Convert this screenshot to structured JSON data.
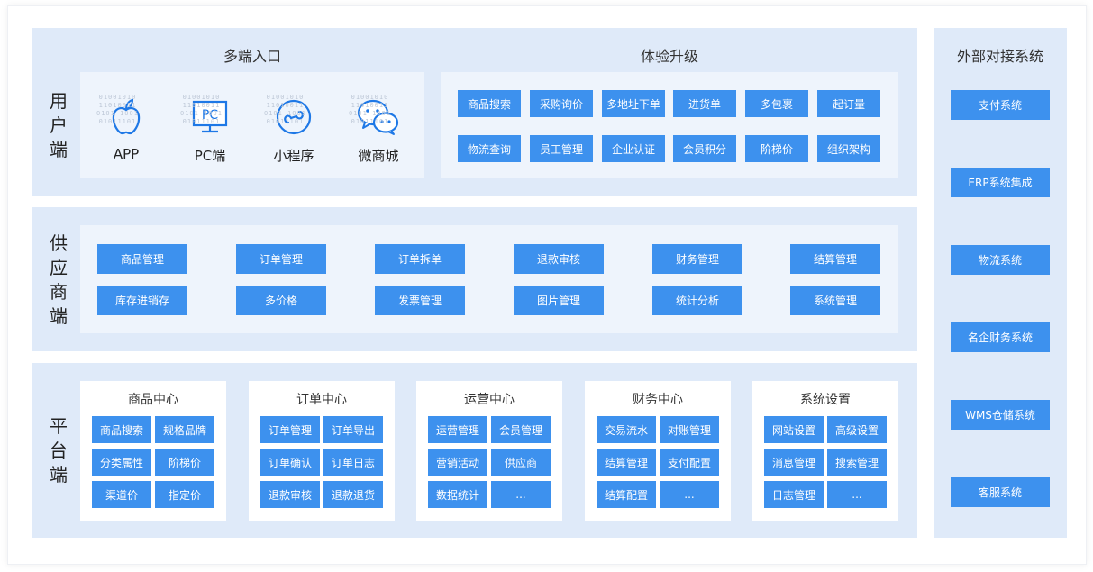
{
  "user_side": {
    "label": "用户端",
    "entries": {
      "title": "多端入口",
      "items": [
        {
          "label": "APP",
          "icon": "apple-icon"
        },
        {
          "label": "PC端",
          "icon": "pc-icon"
        },
        {
          "label": "小程序",
          "icon": "mini-program-icon"
        },
        {
          "label": "微商城",
          "icon": "wechat-icon"
        }
      ]
    },
    "experience": {
      "title": "体验升级",
      "row1": [
        "商品搜索",
        "采购询价",
        "多地址下单",
        "进货单",
        "多包裹",
        "起订量"
      ],
      "row2": [
        "物流查询",
        "员工管理",
        "企业认证",
        "会员积分",
        "阶梯价",
        "组织架构"
      ]
    }
  },
  "supplier_side": {
    "label": "供应商端",
    "row1": [
      "商品管理",
      "订单管理",
      "订单拆单",
      "退款审核",
      "财务管理",
      "结算管理"
    ],
    "row2": [
      "库存进销存",
      "多价格",
      "发票管理",
      "图片管理",
      "统计分析",
      "系统管理"
    ]
  },
  "platform_side": {
    "label": "平台端",
    "groups": [
      {
        "title": "商品中心",
        "items": [
          "商品搜索",
          "规格品牌",
          "分类属性",
          "阶梯价",
          "渠道价",
          "指定价"
        ]
      },
      {
        "title": "订单中心",
        "items": [
          "订单管理",
          "订单导出",
          "订单确认",
          "订单日志",
          "退款审核",
          "退款退货"
        ]
      },
      {
        "title": "运营中心",
        "items": [
          "运营管理",
          "会员管理",
          "营销活动",
          "供应商",
          "数据统计",
          "..."
        ]
      },
      {
        "title": "财务中心",
        "items": [
          "交易流水",
          "对账管理",
          "结算管理",
          "支付配置",
          "结算配置",
          "..."
        ]
      },
      {
        "title": "系统设置",
        "items": [
          "网站设置",
          "高级设置",
          "消息管理",
          "搜索管理",
          "日志管理",
          "..."
        ]
      }
    ]
  },
  "external": {
    "title": "外部对接系统",
    "items": [
      "支付系统",
      "ERP系统集成",
      "物流系统",
      "名企财务系统",
      "WMS仓储系统",
      "客服系统"
    ]
  },
  "colors": {
    "button": "#3d91ee",
    "section_bg": "#dfeaf9",
    "inner_bg": "#eef4fc",
    "icon": "#1e78e6"
  }
}
